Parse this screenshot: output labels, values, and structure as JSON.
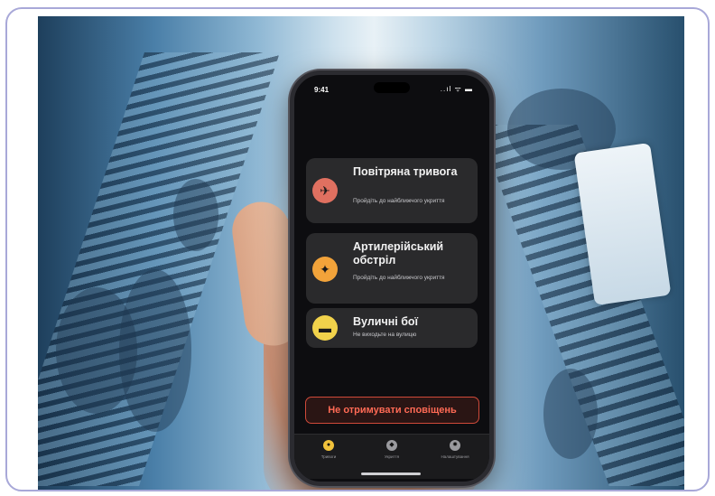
{
  "colors": {
    "frame": "#a8a8d8",
    "accent_orange": "#f2a33a",
    "accent_red": "#d04a3a",
    "alert_yellow": "#f1d24b",
    "card_bg": "#2a2a2c"
  },
  "phone": {
    "status": {
      "time": "9:41",
      "icons": "..ıl ᯤ ▬"
    },
    "alerts": [
      {
        "icon": "missile-icon",
        "title": "Повітряна тривога",
        "subtitle": "Пройдіть до найближчого укриття",
        "color": "#e07060"
      },
      {
        "icon": "artillery-icon",
        "title": "Артилерійський обстріл",
        "subtitle": "Пройдіть до найближчого укриття",
        "color": "#f2a33a"
      },
      {
        "icon": "rifle-icon",
        "title": "Вуличні бої",
        "subtitle": "Не виходьте на вулицю",
        "color": "#f1d24b"
      }
    ],
    "mute_button": "Не отримувати сповіщень",
    "tabs": [
      {
        "icon": "alert-icon",
        "label": "Тривоги",
        "color": "#f1c23b"
      },
      {
        "icon": "map-icon",
        "label": "Укриття",
        "color": "#9a9a9e"
      },
      {
        "icon": "settings-icon",
        "label": "Налаштування",
        "color": "#9a9a9e"
      }
    ]
  }
}
